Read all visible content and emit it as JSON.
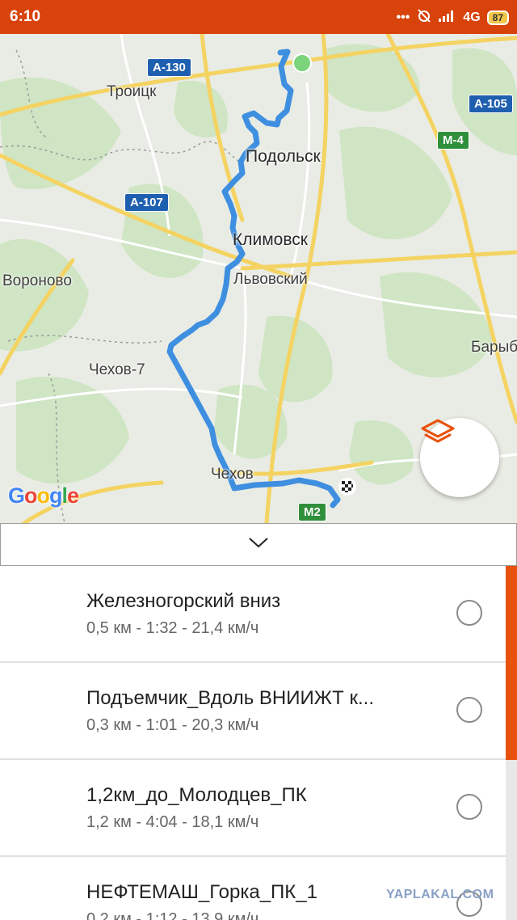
{
  "status_bar": {
    "time": "6:10",
    "network": "4G",
    "battery": "87",
    "icons": [
      "more-dots-icon",
      "alarm-off-icon",
      "signal-icon",
      "network-icon",
      "battery-icon"
    ]
  },
  "map": {
    "road_badges": [
      "A-130",
      "A-105",
      "M-4",
      "A-107",
      "M2"
    ],
    "towns": [
      "Троицк",
      "Подольск",
      "Климовск",
      "Львовский",
      "Вороново",
      "Чехов-7",
      "Чехов",
      "Барыб"
    ],
    "attribution": "Google",
    "layers_button_icon": "layers-icon",
    "route_color": "#3f8fe0",
    "start_marker_color": "#7bd37b",
    "finish_marker_icon": "checkered-flag-icon"
  },
  "collapse_toggle_icon": "chevron-down-icon",
  "segments": [
    {
      "name": "Железногорский вниз",
      "meta": "0,5 км - 1:32 - 21,4 км/ч"
    },
    {
      "name": "Подъемчик_Вдоль ВНИИЖТ к...",
      "meta": "0,3 км - 1:01 - 20,3 км/ч"
    },
    {
      "name": "1,2км_до_Молодцев_ПК",
      "meta": "1,2 км - 4:04 - 18,1 км/ч"
    },
    {
      "name": "НЕФТЕМАШ_Горка_ПК_1",
      "meta": "0,2 км - 1:12 - 13,9 км/ч"
    }
  ],
  "watermark": "YAPLAKAL.COM",
  "accent_color": "#e8520c"
}
